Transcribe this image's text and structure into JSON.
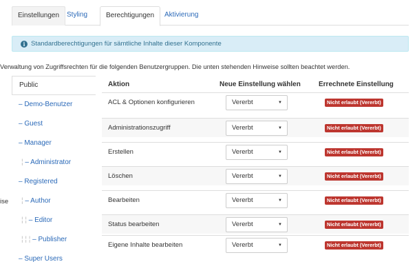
{
  "tabs": [
    "Einstellungen",
    "Styling",
    "Berechtigungen",
    "Aktivierung"
  ],
  "alert": {
    "icon": "info-icon",
    "text": "Standardberechtigungen für sämtliche Inhalte dieser Komponente"
  },
  "intro": "Verwaltung von Zugriffsrechten für die folgenden Benutzergruppen. Die unten stehenden Hinweise sollten beachtet werden.",
  "left_cut_text": "ise",
  "groups": [
    {
      "label": "Public",
      "prefix": ""
    },
    {
      "label": "– Demo-Benutzer",
      "prefix": ""
    },
    {
      "label": "– Guest",
      "prefix": ""
    },
    {
      "label": "– Manager",
      "prefix": ""
    },
    {
      "label": "– Administrator",
      "prefix": "¦ "
    },
    {
      "label": "– Registered",
      "prefix": ""
    },
    {
      "label": "– Author",
      "prefix": "¦ "
    },
    {
      "label": "– Editor",
      "prefix": "¦ ¦ "
    },
    {
      "label": "– Publisher",
      "prefix": "¦ ¦ ¦ "
    },
    {
      "label": "– Super Users",
      "prefix": ""
    }
  ],
  "table": {
    "headers": [
      "Aktion",
      "Neue Einstellung wählen",
      "Errechnete Einstellung"
    ],
    "rows": [
      {
        "action": "ACL & Optionen konfigurieren",
        "select": "Vererbt",
        "calc": "Nicht erlaubt (Vererbt)"
      },
      {
        "action": "Administrationszugriff",
        "select": "Vererbt",
        "calc": "Nicht erlaubt (Vererbt)"
      },
      {
        "action": "Erstellen",
        "select": "Vererbt",
        "calc": "Nicht erlaubt (Vererbt)"
      },
      {
        "action": "Löschen",
        "select": "Vererbt",
        "calc": "Nicht erlaubt (Vererbt)"
      },
      {
        "action": "Bearbeiten",
        "select": "Vererbt",
        "calc": "Nicht erlaubt (Vererbt)"
      },
      {
        "action": "Status bearbeiten",
        "select": "Vererbt",
        "calc": "Nicht erlaubt (Vererbt)"
      },
      {
        "action": "Eigene Inhalte bearbeiten",
        "select": "Vererbt",
        "calc": "Nicht erlaubt (Vererbt)"
      }
    ]
  },
  "colors": {
    "link": "#2a69b8",
    "alert_bg": "#d9edf7",
    "badge": "#bd362f"
  }
}
